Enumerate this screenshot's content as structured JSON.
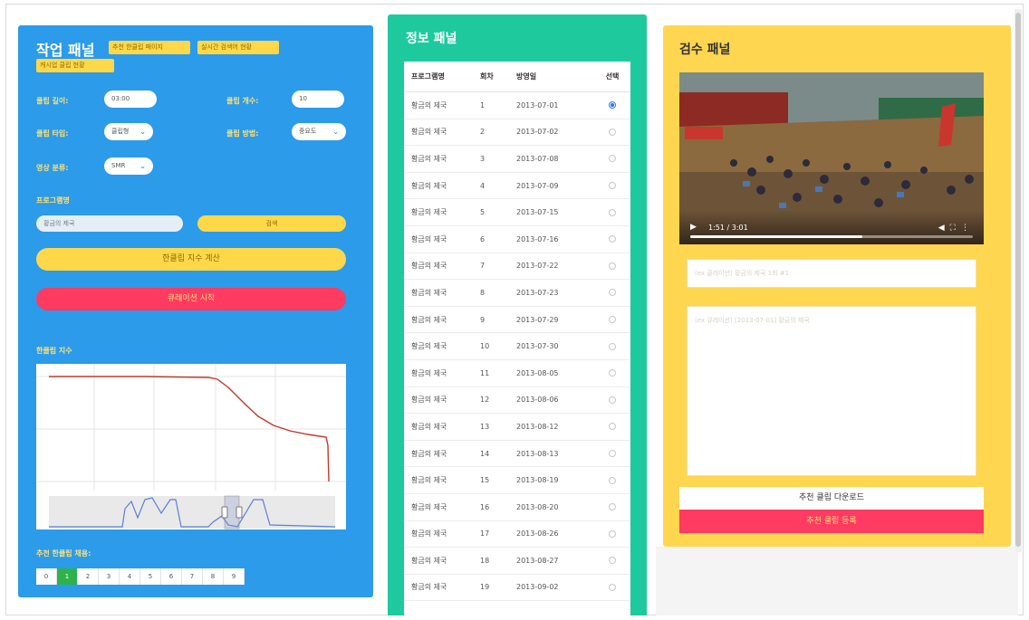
{
  "work_panel": {
    "title": "작업 패널",
    "header_buttons": [
      "추천 한클립 페이지",
      "실시간 검색어 현황",
      "캐시업 클립 현황"
    ],
    "fields": {
      "clip_length_label": "클립 길이:",
      "clip_length_value": "03:00",
      "clip_count_label": "클립 개수:",
      "clip_count_value": "10",
      "clip_type_label": "클립 타입:",
      "clip_type_value": "클립형",
      "clip_method_label": "클립 방법:",
      "clip_method_value": "중요도",
      "video_category_label": "영상 분류:",
      "video_category_value": "SMR"
    },
    "program_label": "프로그램명",
    "program_value": "황금의 제국",
    "search_button": "검색",
    "index_button": "한클립 지수 계산",
    "curation_button": "큐레이션 시작",
    "chart_label": "한클립 지수",
    "recommend_label": "추천 한클립 채용:",
    "pager": [
      "0",
      "1",
      "2",
      "3",
      "4",
      "5",
      "6",
      "7",
      "8",
      "9"
    ],
    "pager_active": "1",
    "colors": {
      "panel": "#2b9bea",
      "accent_yellow": "#ffd84a",
      "accent_red": "#ff3b61",
      "active_green": "#2fb24e"
    }
  },
  "info_panel": {
    "title": "정보 패널",
    "columns": [
      "프로그램명",
      "회차",
      "방영일",
      "선택"
    ],
    "rows": [
      {
        "program": "황금의 제국",
        "episode": "1",
        "date": "2013-07-01",
        "selected": true
      },
      {
        "program": "황금의 제국",
        "episode": "2",
        "date": "2013-07-02",
        "selected": false
      },
      {
        "program": "황금의 제국",
        "episode": "3",
        "date": "2013-07-08",
        "selected": false
      },
      {
        "program": "황금의 제국",
        "episode": "4",
        "date": "2013-07-09",
        "selected": false
      },
      {
        "program": "황금의 제국",
        "episode": "5",
        "date": "2013-07-15",
        "selected": false
      },
      {
        "program": "황금의 제국",
        "episode": "6",
        "date": "2013-07-16",
        "selected": false
      },
      {
        "program": "황금의 제국",
        "episode": "7",
        "date": "2013-07-22",
        "selected": false
      },
      {
        "program": "황금의 제국",
        "episode": "8",
        "date": "2013-07-23",
        "selected": false
      },
      {
        "program": "황금의 제국",
        "episode": "9",
        "date": "2013-07-29",
        "selected": false
      },
      {
        "program": "황금의 제국",
        "episode": "10",
        "date": "2013-07-30",
        "selected": false
      },
      {
        "program": "황금의 제국",
        "episode": "11",
        "date": "2013-08-05",
        "selected": false
      },
      {
        "program": "황금의 제국",
        "episode": "12",
        "date": "2013-08-06",
        "selected": false
      },
      {
        "program": "황금의 제국",
        "episode": "13",
        "date": "2013-08-12",
        "selected": false
      },
      {
        "program": "황금의 제국",
        "episode": "14",
        "date": "2013-08-13",
        "selected": false
      },
      {
        "program": "황금의 제국",
        "episode": "15",
        "date": "2013-08-19",
        "selected": false
      },
      {
        "program": "황금의 제국",
        "episode": "16",
        "date": "2013-08-20",
        "selected": false
      },
      {
        "program": "황금의 제국",
        "episode": "17",
        "date": "2013-08-26",
        "selected": false
      },
      {
        "program": "황금의 제국",
        "episode": "18",
        "date": "2013-08-27",
        "selected": false
      },
      {
        "program": "황금의 제국",
        "episode": "19",
        "date": "2013-09-02",
        "selected": false
      }
    ],
    "colors": {
      "panel": "#1fc99e",
      "radio_selected": "#3478f6"
    }
  },
  "review_panel": {
    "title": "검수 패널",
    "video": {
      "time": "1:51 / 3:01",
      "progress": 0.61,
      "play_icon": "play-icon"
    },
    "title_input_placeholder": "(ex 클레이션) 황금의 제국 1회 #1",
    "description_placeholder": "(ex 큐레이션) [2013-07-01] 황금의 제국",
    "download_button": "추천 클립 다운로드",
    "register_button": "추천 클립 등록",
    "colors": {
      "panel": "#ffd64f",
      "register": "#ff3b61"
    }
  }
}
